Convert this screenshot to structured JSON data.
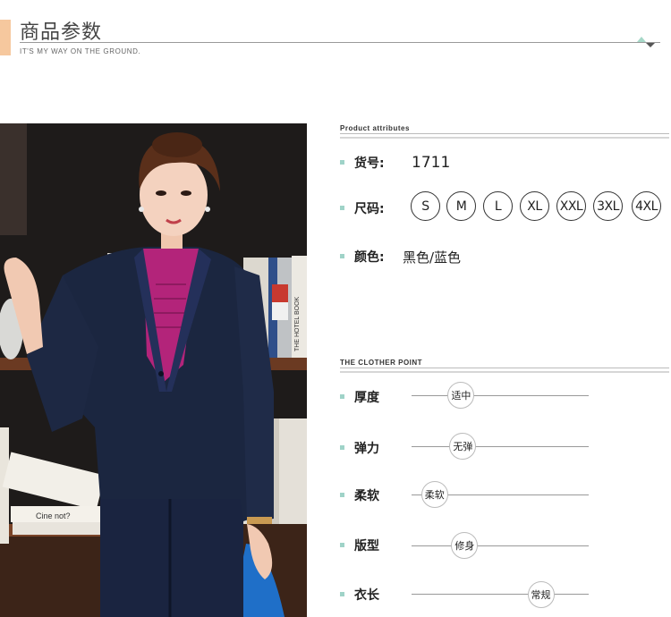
{
  "header": {
    "title": "商品参数",
    "subtitle": "IT'S MY WAY ON THE GROUND."
  },
  "attributes": {
    "section_title": "Product attributes",
    "sku_label": "货号:",
    "sku_value": "1711",
    "size_label": "尺码:",
    "sizes": [
      "S",
      "M",
      "L",
      "XL",
      "XXL",
      "3XL",
      "4XL"
    ],
    "color_label": "颜色:",
    "color_value": "黑色/蓝色"
  },
  "clother_point": {
    "section_title": "THE CLOTHER POINT",
    "items": [
      {
        "label": "厚度",
        "value": "适中",
        "level": 0.28
      },
      {
        "label": "弹力",
        "value": "无弹",
        "level": 0.29
      },
      {
        "label": "柔软",
        "value": "柔软",
        "level": 0.13
      },
      {
        "label": "版型",
        "value": "修身",
        "level": 0.3
      },
      {
        "label": "衣长",
        "value": "常规",
        "level": 0.73
      }
    ]
  },
  "photo": {
    "book_spine_text": "THE HOTEL BOOK",
    "book_text": "Cine not?"
  },
  "colors": {
    "accent": "#f6c89e",
    "bullet": "#9fd3c8",
    "suit": "#1b2640",
    "shirt": "#b3247a"
  }
}
